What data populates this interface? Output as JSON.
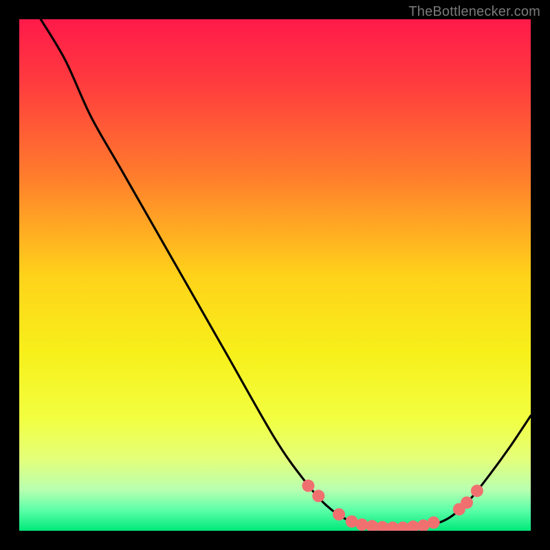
{
  "watermark": "TheBottlenecker.com",
  "chart_data": {
    "type": "line",
    "title": "",
    "xlabel": "",
    "ylabel": "",
    "xlim": [
      0,
      100
    ],
    "ylim": [
      0,
      100
    ],
    "background_gradient": {
      "stops": [
        {
          "offset": 0.0,
          "color": "#ff1a4a"
        },
        {
          "offset": 0.12,
          "color": "#ff3a3f"
        },
        {
          "offset": 0.3,
          "color": "#ff7a2d"
        },
        {
          "offset": 0.5,
          "color": "#ffd21a"
        },
        {
          "offset": 0.65,
          "color": "#f7ef1a"
        },
        {
          "offset": 0.78,
          "color": "#f2ff40"
        },
        {
          "offset": 0.86,
          "color": "#e4ff7a"
        },
        {
          "offset": 0.92,
          "color": "#b8ffb0"
        },
        {
          "offset": 0.96,
          "color": "#5bffa8"
        },
        {
          "offset": 1.0,
          "color": "#00e879"
        }
      ]
    },
    "curve": [
      {
        "x": 4.2,
        "y": 100.0
      },
      {
        "x": 9.0,
        "y": 92.0
      },
      {
        "x": 14.0,
        "y": 81.0
      },
      {
        "x": 20.0,
        "y": 70.5
      },
      {
        "x": 30.0,
        "y": 53.0
      },
      {
        "x": 40.0,
        "y": 35.5
      },
      {
        "x": 50.0,
        "y": 18.0
      },
      {
        "x": 56.0,
        "y": 9.5
      },
      {
        "x": 60.0,
        "y": 5.0
      },
      {
        "x": 64.0,
        "y": 2.2
      },
      {
        "x": 68.0,
        "y": 1.0
      },
      {
        "x": 72.0,
        "y": 0.6
      },
      {
        "x": 76.0,
        "y": 0.6
      },
      {
        "x": 80.0,
        "y": 1.0
      },
      {
        "x": 84.0,
        "y": 2.5
      },
      {
        "x": 88.0,
        "y": 6.0
      },
      {
        "x": 92.0,
        "y": 11.0
      },
      {
        "x": 96.0,
        "y": 16.5
      },
      {
        "x": 100.0,
        "y": 22.5
      }
    ],
    "markers": [
      {
        "x": 56.5,
        "y": 8.8
      },
      {
        "x": 58.5,
        "y": 6.8
      },
      {
        "x": 62.5,
        "y": 3.2
      },
      {
        "x": 65.0,
        "y": 1.8
      },
      {
        "x": 67.0,
        "y": 1.2
      },
      {
        "x": 69.0,
        "y": 0.9
      },
      {
        "x": 71.0,
        "y": 0.7
      },
      {
        "x": 73.0,
        "y": 0.6
      },
      {
        "x": 75.0,
        "y": 0.6
      },
      {
        "x": 77.0,
        "y": 0.8
      },
      {
        "x": 79.0,
        "y": 1.0
      },
      {
        "x": 81.0,
        "y": 1.6
      },
      {
        "x": 86.0,
        "y": 4.2
      },
      {
        "x": 87.5,
        "y": 5.5
      },
      {
        "x": 89.5,
        "y": 7.8
      }
    ],
    "marker_color": "#f07070",
    "marker_radius": 9,
    "curve_stroke": "#000000",
    "curve_width": 3.2
  }
}
